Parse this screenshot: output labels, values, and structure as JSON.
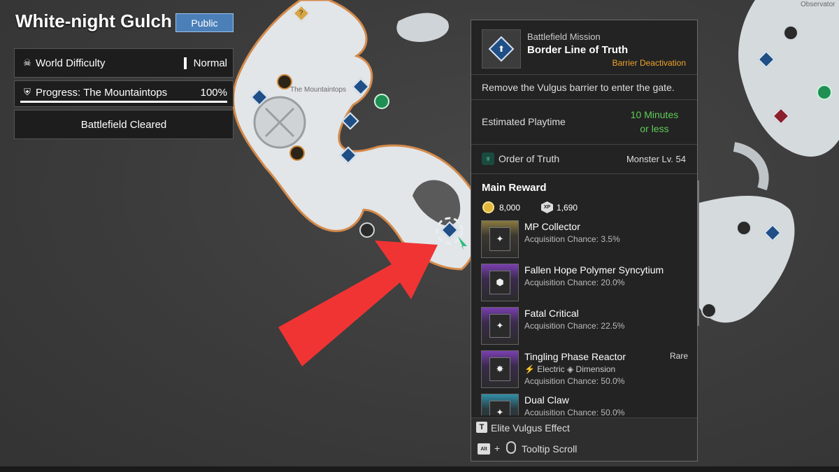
{
  "region": {
    "title": "White-night Gulch",
    "visibility": "Public"
  },
  "status": {
    "difficulty_label": "World Difficulty",
    "difficulty_value": "Normal",
    "progress_label": "Progress: The Mountaintops",
    "progress_value": "100%",
    "progress_fraction": 1.0,
    "cleared_label": "Battlefield Cleared"
  },
  "map": {
    "area_label": "The Mountaintops",
    "corner_label": "Observator",
    "unknown_marker": "?"
  },
  "mission": {
    "type": "Battlefield Mission",
    "name": "Border Line of Truth",
    "subtitle": "Barrier Deactivation",
    "description": "Remove the Vulgus barrier to enter the gate.",
    "playtime_label": "Estimated Playtime",
    "playtime_value_line1": "10 Minutes",
    "playtime_value_line2": "or less",
    "faction": "Order of Truth",
    "monster_level": "Monster Lv. 54",
    "reward_title": "Main Reward",
    "gold": "8,000",
    "xp": "1,690",
    "xp_icon_text": "XP"
  },
  "rewards": [
    {
      "name": "MP Collector",
      "chance": "Acquisition Chance: 3.5%",
      "thumb": "gold",
      "icon": "module-icon"
    },
    {
      "name": "Fallen Hope Polymer Syncytium",
      "chance": "Acquisition Chance: 20.0%",
      "thumb": "purple",
      "icon": "material-icon"
    },
    {
      "name": "Fatal Critical",
      "chance": "Acquisition Chance: 22.5%",
      "thumb": "purple",
      "icon": "module-icon"
    },
    {
      "name": "Tingling Phase Reactor",
      "rarity": "Rare",
      "tag1": "Electric",
      "tag2": "Dimension",
      "chance": "Acquisition Chance: 50.0%",
      "thumb": "purple",
      "icon": "reactor-icon"
    },
    {
      "name": "Dual Claw",
      "chance": "Acquisition Chance: 50.0%",
      "thumb": "teal",
      "icon": "module-icon"
    }
  ],
  "footer": {
    "elite_key": "T",
    "elite_label": "Elite Vulgus Effect",
    "scroll_key": "Alt",
    "plus": "+",
    "scroll_label": "Tooltip Scroll"
  },
  "colors": {
    "accent_blue": "#4b7fb8",
    "playtime_green": "#5fcc58",
    "subtitle_orange": "#f0a32a",
    "arrow_red": "#f03434"
  }
}
